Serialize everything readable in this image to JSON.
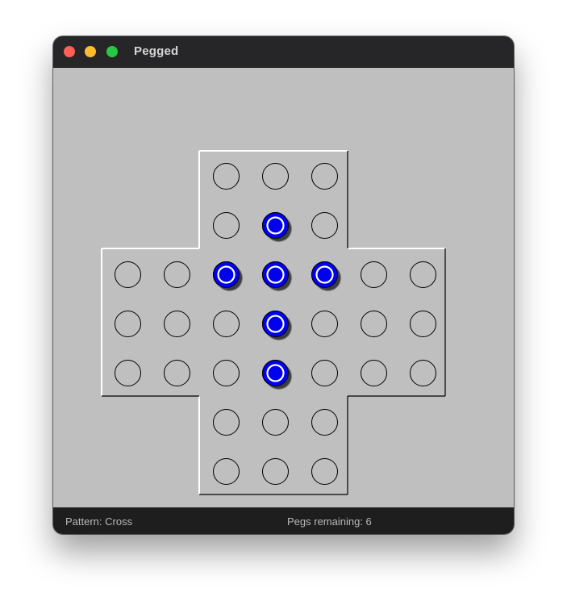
{
  "window": {
    "title": "Pegged"
  },
  "statusbar": {
    "pattern_text": "Pattern: Cross",
    "pegs_text": "Pegs remaining: 6"
  },
  "colors": {
    "board_bg": "#bfbfbf",
    "peg_fill": "#0000ee",
    "peg_ring": "#ffffff",
    "hole_stroke": "#000000"
  },
  "board": {
    "shape": "english-cross",
    "size": 7,
    "pegs": [
      [
        1,
        3
      ],
      [
        2,
        2
      ],
      [
        2,
        3
      ],
      [
        2,
        4
      ],
      [
        3,
        3
      ],
      [
        4,
        3
      ]
    ]
  }
}
